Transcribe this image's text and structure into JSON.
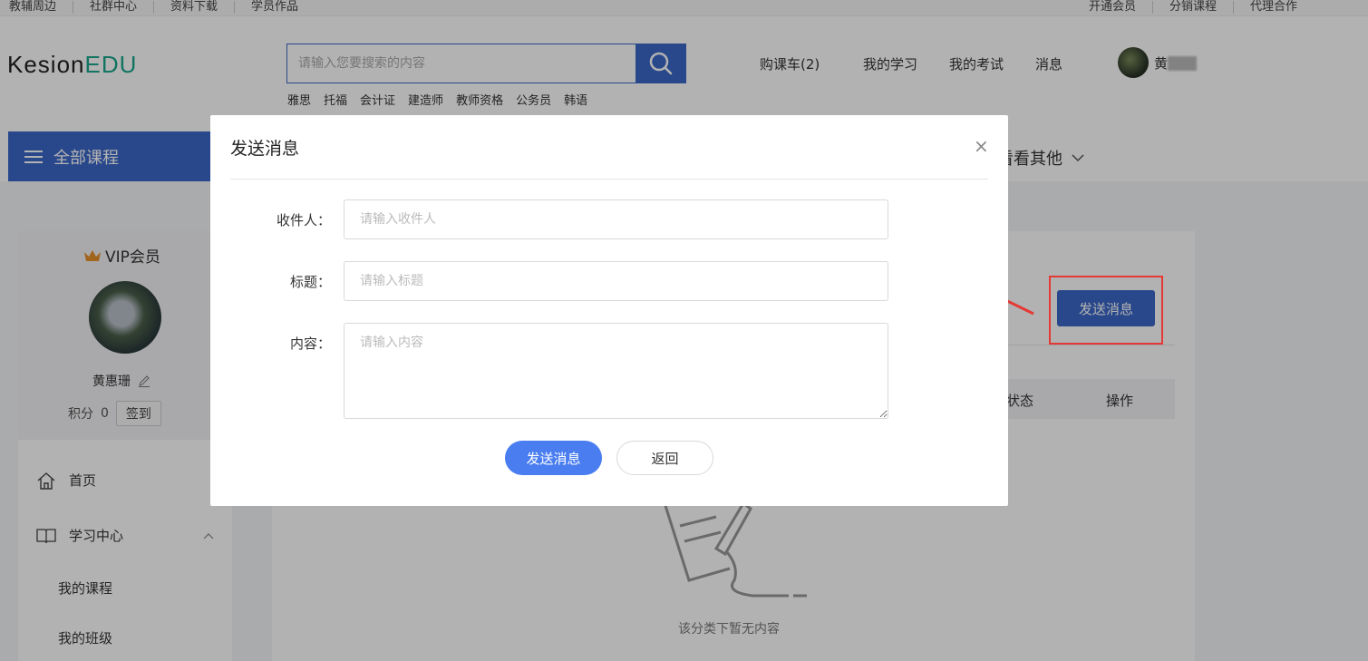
{
  "topbar": {
    "left_links": [
      "教辅周边",
      "社群中心",
      "资料下载",
      "学员作品"
    ],
    "right_links": [
      "开通会员",
      "分销课程",
      "代理合作"
    ]
  },
  "header": {
    "logo_part1": "Kesion",
    "logo_part2": "EDU",
    "search_placeholder": "请输入您要搜索的内容",
    "hotwords": [
      "雅思",
      "托福",
      "会计证",
      "建造师",
      "教师资格",
      "公务员",
      "韩语"
    ],
    "nav": {
      "cart": "购课车(2)",
      "my_learning": "我的学习",
      "my_exam": "我的考试",
      "messages": "消息"
    },
    "user_name": "黄"
  },
  "catbar": {
    "all_courses": "全部课程",
    "see_other": "看看其他"
  },
  "sidebar": {
    "vip_label": "VIP会员",
    "name": "黄惠珊",
    "points_label": "积分",
    "points_value": "0",
    "signin_label": "签到",
    "menu": {
      "home": "首页",
      "learning_center": "学习中心",
      "my_courses": "我的课程",
      "my_class": "我的班级"
    }
  },
  "main": {
    "send_button": "发送消息",
    "col_status": "状态",
    "col_action": "操作",
    "empty_text": "该分类下暂无内容"
  },
  "modal": {
    "title": "发送消息",
    "close": "×",
    "recipient_label": "收件人：",
    "recipient_placeholder": "请输入收件人",
    "subject_label": "标题：",
    "subject_placeholder": "请输入标题",
    "content_label": "内容：",
    "content_placeholder": "请输入内容",
    "submit_label": "发送消息",
    "back_label": "返回"
  },
  "colors": {
    "brand_blue": "#3b67c8",
    "button_blue": "#4a7ef0",
    "logo_green": "#1aa78c",
    "annotation_red": "#e53935"
  }
}
